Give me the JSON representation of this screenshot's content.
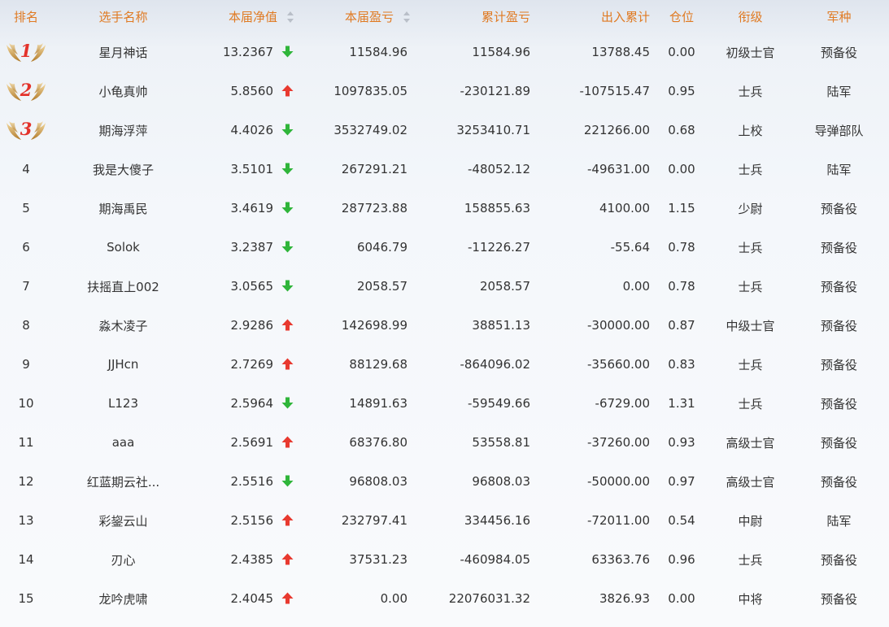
{
  "headers": {
    "rank": "排名",
    "name": "选手名称",
    "nav": "本届净值",
    "pnl": "本届盈亏",
    "cum": "累计盈亏",
    "flow": "出入累计",
    "pos": "仓位",
    "grade": "衔级",
    "arm": "军种"
  },
  "colors": {
    "header_text": "#e07a22",
    "up": "#e8392f",
    "down": "#2fb53a",
    "medal_number": "#e3322b"
  },
  "rows": [
    {
      "rank": "1",
      "medal": true,
      "name": "星月神话",
      "nav": "13.2367",
      "trend": "down",
      "pnl": "11584.96",
      "cum": "11584.96",
      "flow": "13788.45",
      "pos": "0.00",
      "grade": "初级士官",
      "arm": "预备役"
    },
    {
      "rank": "2",
      "medal": true,
      "name": "小龟真帅",
      "nav": "5.8560",
      "trend": "up",
      "pnl": "1097835.05",
      "cum": "-230121.89",
      "flow": "-107515.47",
      "pos": "0.95",
      "grade": "士兵",
      "arm": "陆军"
    },
    {
      "rank": "3",
      "medal": true,
      "name": "期海浮萍",
      "nav": "4.4026",
      "trend": "down",
      "pnl": "3532749.02",
      "cum": "3253410.71",
      "flow": "221266.00",
      "pos": "0.68",
      "grade": "上校",
      "arm": "导弹部队"
    },
    {
      "rank": "4",
      "medal": false,
      "name": "我是大傻子",
      "nav": "3.5101",
      "trend": "down",
      "pnl": "267291.21",
      "cum": "-48052.12",
      "flow": "-49631.00",
      "pos": "0.00",
      "grade": "士兵",
      "arm": "陆军"
    },
    {
      "rank": "5",
      "medal": false,
      "name": "期海禹民",
      "nav": "3.4619",
      "trend": "down",
      "pnl": "287723.88",
      "cum": "158855.63",
      "flow": "4100.00",
      "pos": "1.15",
      "grade": "少尉",
      "arm": "预备役"
    },
    {
      "rank": "6",
      "medal": false,
      "name": "Solok",
      "nav": "3.2387",
      "trend": "down",
      "pnl": "6046.79",
      "cum": "-11226.27",
      "flow": "-55.64",
      "pos": "0.78",
      "grade": "士兵",
      "arm": "预备役"
    },
    {
      "rank": "7",
      "medal": false,
      "name": "扶摇直上002",
      "nav": "3.0565",
      "trend": "down",
      "pnl": "2058.57",
      "cum": "2058.57",
      "flow": "0.00",
      "pos": "0.78",
      "grade": "士兵",
      "arm": "预备役"
    },
    {
      "rank": "8",
      "medal": false,
      "name": "淼木凌子",
      "nav": "2.9286",
      "trend": "up",
      "pnl": "142698.99",
      "cum": "38851.13",
      "flow": "-30000.00",
      "pos": "0.87",
      "grade": "中级士官",
      "arm": "预备役"
    },
    {
      "rank": "9",
      "medal": false,
      "name": "JJHcn",
      "nav": "2.7269",
      "trend": "up",
      "pnl": "88129.68",
      "cum": "-864096.02",
      "flow": "-35660.00",
      "pos": "0.83",
      "grade": "士兵",
      "arm": "预备役"
    },
    {
      "rank": "10",
      "medal": false,
      "name": "L123",
      "nav": "2.5964",
      "trend": "down",
      "pnl": "14891.63",
      "cum": "-59549.66",
      "flow": "-6729.00",
      "pos": "1.31",
      "grade": "士兵",
      "arm": "预备役"
    },
    {
      "rank": "11",
      "medal": false,
      "name": "aaa",
      "nav": "2.5691",
      "trend": "up",
      "pnl": "68376.80",
      "cum": "53558.81",
      "flow": "-37260.00",
      "pos": "0.93",
      "grade": "高级士官",
      "arm": "预备役"
    },
    {
      "rank": "12",
      "medal": false,
      "name": "红蓝期云社...",
      "nav": "2.5516",
      "trend": "down",
      "pnl": "96808.03",
      "cum": "96808.03",
      "flow": "-50000.00",
      "pos": "0.97",
      "grade": "高级士官",
      "arm": "预备役"
    },
    {
      "rank": "13",
      "medal": false,
      "name": "彩鋆云山",
      "nav": "2.5156",
      "trend": "up",
      "pnl": "232797.41",
      "cum": "334456.16",
      "flow": "-72011.00",
      "pos": "0.54",
      "grade": "中尉",
      "arm": "陆军"
    },
    {
      "rank": "14",
      "medal": false,
      "name": "刃心",
      "nav": "2.4385",
      "trend": "up",
      "pnl": "37531.23",
      "cum": "-460984.05",
      "flow": "63363.76",
      "pos": "0.96",
      "grade": "士兵",
      "arm": "预备役"
    },
    {
      "rank": "15",
      "medal": false,
      "name": "龙吟虎啸",
      "nav": "2.4045",
      "trend": "up",
      "pnl": "0.00",
      "cum": "22076031.32",
      "flow": "3826.93",
      "pos": "0.00",
      "grade": "中将",
      "arm": "预备役"
    }
  ]
}
